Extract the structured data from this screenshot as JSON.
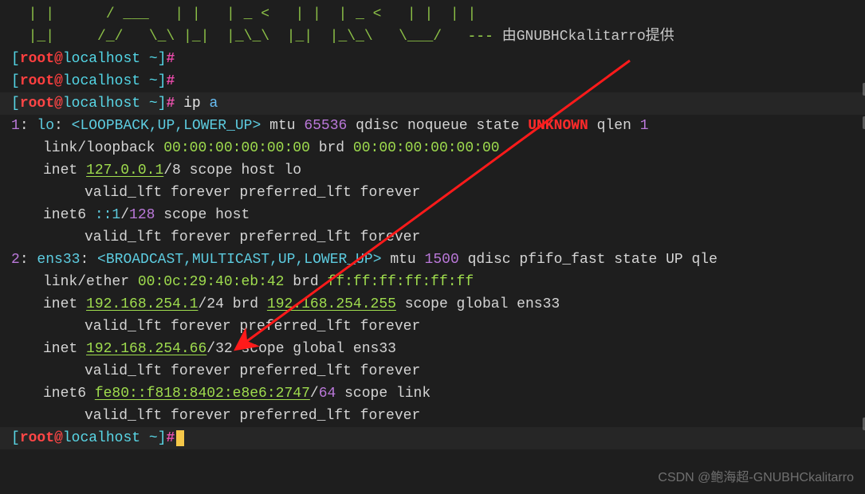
{
  "ascii": {
    "line1": "  | |      / ___   | |   | _ <   | |  | _ <   | |  | |",
    "line2": "  |_|     /_/   \\_\\ |_|  |_\\_\\  |_|  |_\\_\\   \\___/",
    "credit_dash": "   --- ",
    "credit_txt": "由GNUBHCkalitarro提供"
  },
  "prompts": {
    "user": "root",
    "host": "localhost",
    "path": "~",
    "open": "[",
    "close": "]",
    "at": "@",
    "hash": "#"
  },
  "command": {
    "cmd": "ip",
    "arg": "a"
  },
  "iface1": {
    "idx": "1",
    "name": "lo",
    "flags": "<LOOPBACK,UP,LOWER_UP>",
    "mtu": "65536",
    "qdisc": "noqueue",
    "state": "UNKNOWN",
    "qlen": "1",
    "link_type": "link/loopback",
    "mac": "00:00:00:00:00:00",
    "brd": "00:00:00:00:00:00",
    "inet_ip": "127.0.0.1",
    "inet_pfx": "/8",
    "inet_scope": "scope host lo",
    "inet6_ip": "::1",
    "inet6_pfx": "/128",
    "inet6_scope": "scope host"
  },
  "iface2": {
    "idx": "2",
    "name": "ens33",
    "flags": "<BROADCAST,MULTICAST,UP,LOWER_UP>",
    "mtu": "1500",
    "qdisc": "pfifo_fast",
    "state": "UP",
    "tail": "qle",
    "link_type": "link/ether",
    "mac": "00:0c:29:40:eb:42",
    "brd": "ff:ff:ff:ff:ff:ff",
    "inet1_ip": "192.168.254.1",
    "inet1_pfx": "/24",
    "inet1_brd": "192.168.254.255",
    "inet1_scope": "scope global ens33",
    "inet2_ip": "192.168.254.66",
    "inet2_pfx": "/32",
    "inet2_scope": "scope global ens33",
    "inet6_ip": "fe80::f818:8402:e8e6:2747",
    "inet6_pfx": "/64",
    "inet6_scope": "scope link"
  },
  "lft": "valid_lft forever preferred_lft forever",
  "kw": {
    "mtu": "mtu",
    "qdisc": "qdisc",
    "state": "state",
    "qlen": "qlen",
    "brd": "brd",
    "inet": "inet",
    "inet6": "inet6"
  },
  "watermark": "CSDN @鲍海超-GNUBHCkalitarro"
}
